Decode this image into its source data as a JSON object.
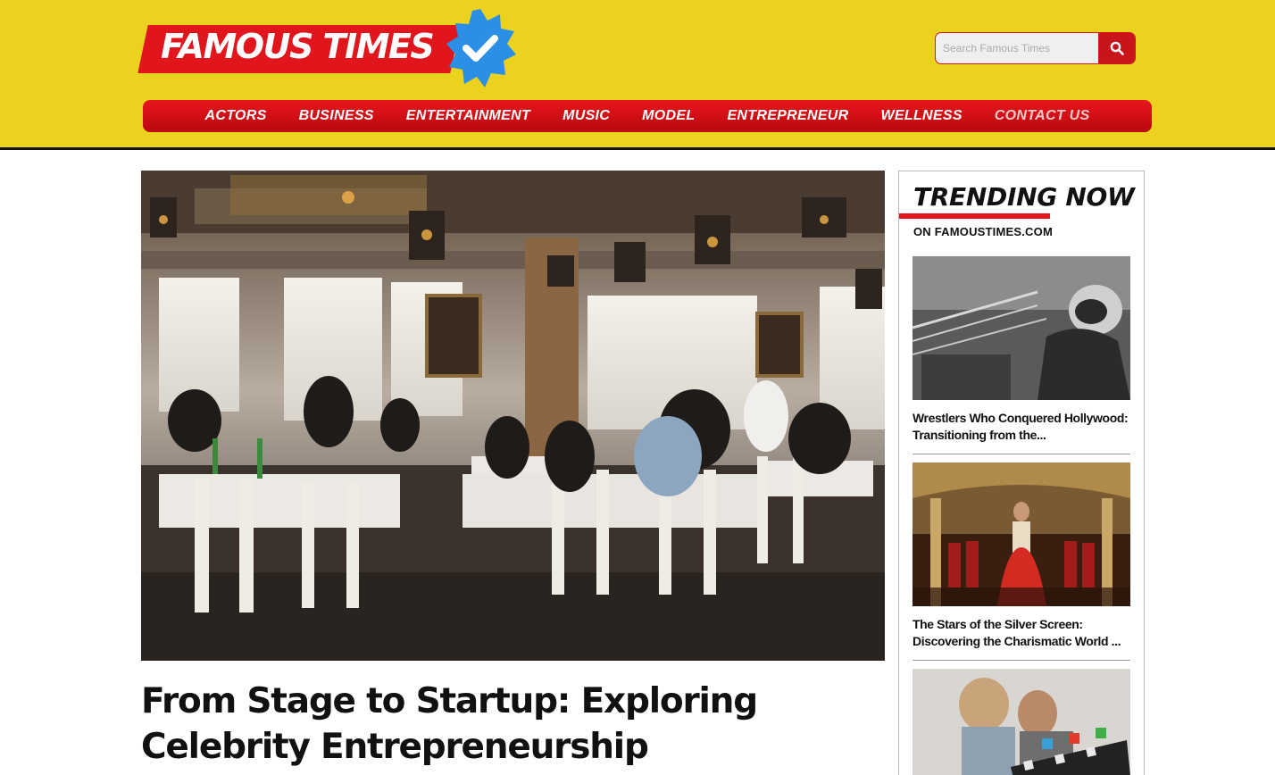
{
  "brand": {
    "name": "FAMOUS TIMES",
    "primary_color": "#e0161c",
    "header_bg": "#ebd21f",
    "badge_color": "#2b8fe6",
    "badge_icon": "verified-check-icon"
  },
  "search": {
    "placeholder": "Search Famous Times",
    "button_icon": "search-icon"
  },
  "nav": {
    "items": [
      {
        "label": "ACTORS"
      },
      {
        "label": "BUSINESS"
      },
      {
        "label": "ENTERTAINMENT"
      },
      {
        "label": "MUSIC"
      },
      {
        "label": "MODEL"
      },
      {
        "label": "ENTREPRENEUR"
      },
      {
        "label": "WELLNESS"
      },
      {
        "label": "CONTACT US"
      }
    ]
  },
  "article": {
    "title": "From Stage to Startup: Exploring Celebrity Entrepreneurship",
    "image_subject": "restaurant-dining-room-photo"
  },
  "trending": {
    "title": "TRENDING NOW",
    "subtitle": "ON FAMOUSTIMES.COM",
    "items": [
      {
        "title": "Wrestlers Who Conquered Hollywood: Transitioning from the...",
        "image_subject": "masked-wrestler-bw-photo"
      },
      {
        "title": "The Stars of the Silver Screen: Discovering the Charismatic World ...",
        "image_subject": "bridal-fashion-show-photo"
      },
      {
        "title": "",
        "image_subject": "film-set-clapperboard-photo"
      }
    ]
  }
}
